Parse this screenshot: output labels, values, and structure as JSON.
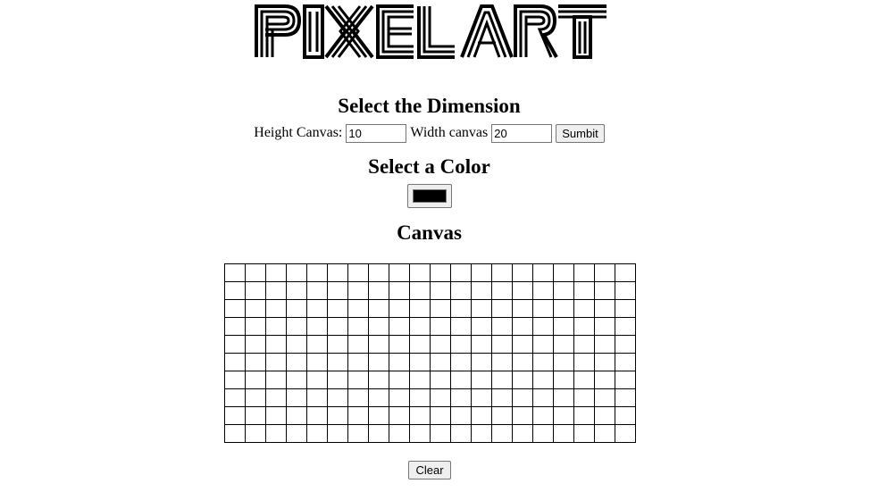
{
  "logo": {
    "text": "PIXEL ART"
  },
  "dimension": {
    "heading": "Select the Dimension",
    "height_label": "Height Canvas:",
    "height_value": "10",
    "width_label": "Width canvas",
    "width_value": "20",
    "submit_label": "Sumbit"
  },
  "color": {
    "heading": "Select a Color",
    "value": "#000000"
  },
  "canvas": {
    "heading": "Canvas",
    "rows": 10,
    "cols": 20
  },
  "clear_label": "Clear"
}
